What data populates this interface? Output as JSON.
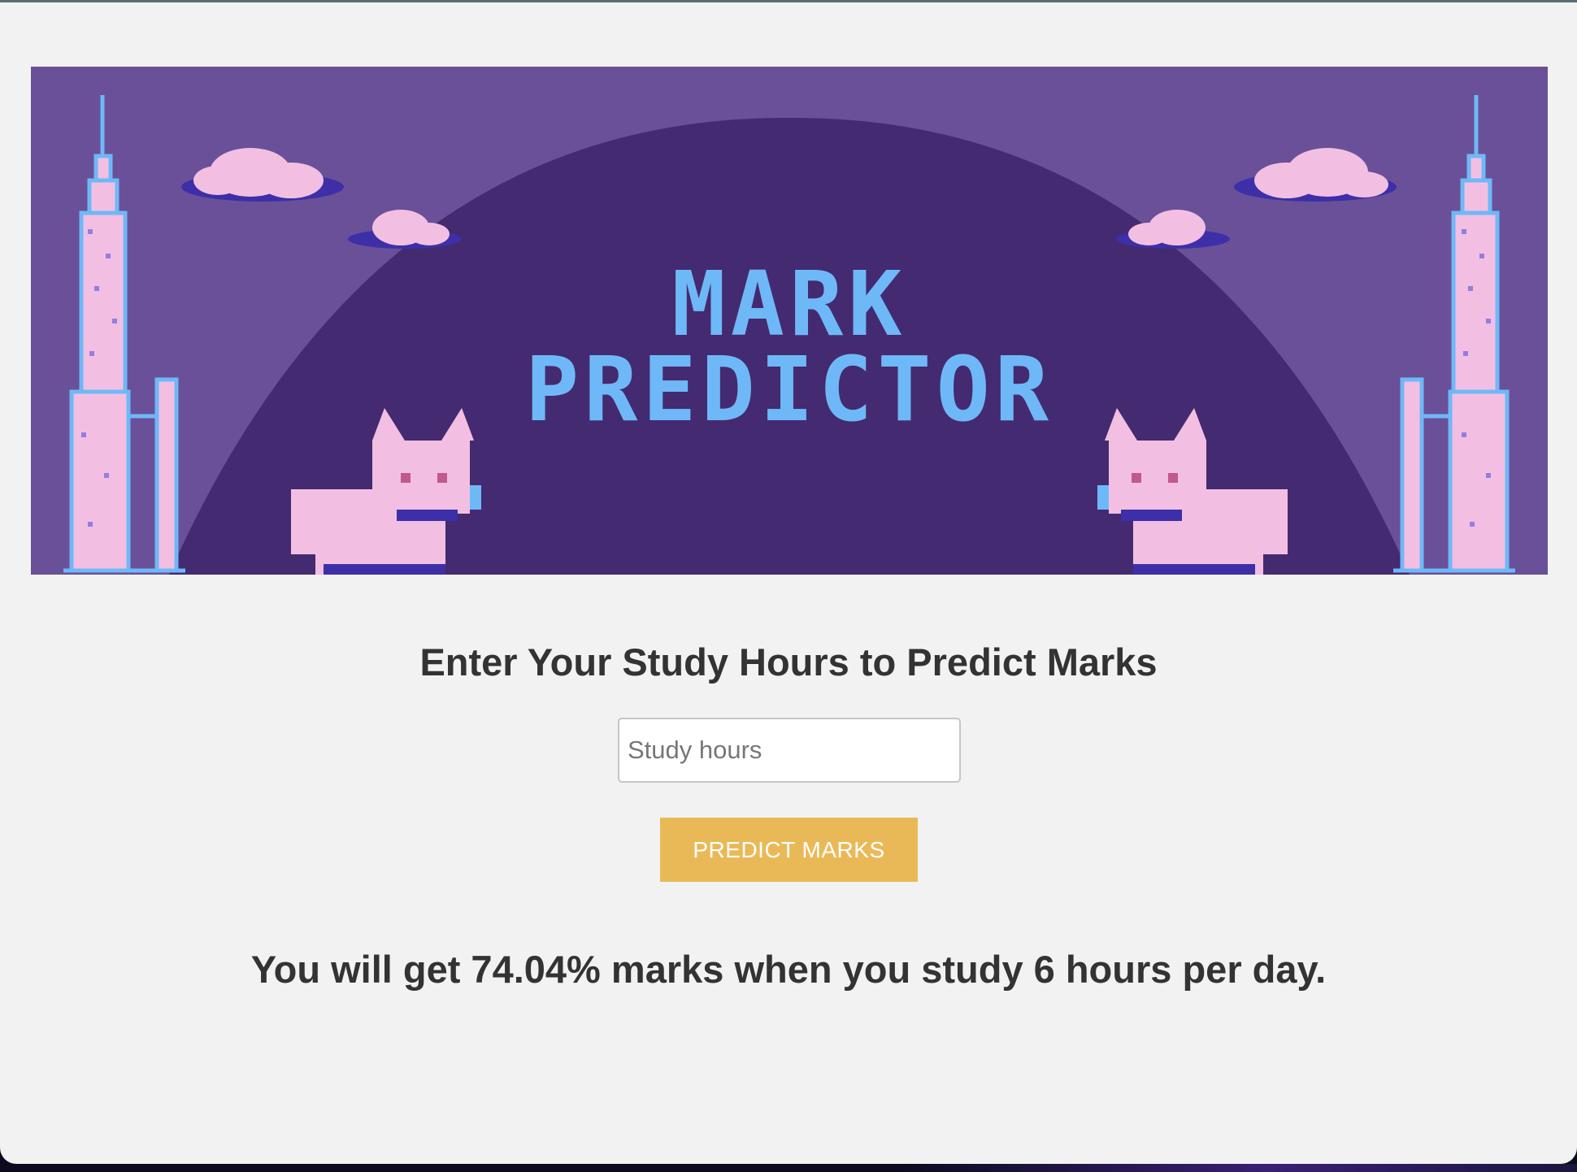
{
  "banner": {
    "title_line1": "MARK",
    "title_line2": "PREDICTOR",
    "background_color": "#6a5099",
    "dome_color": "#442a70",
    "title_color": "#6fb8f7",
    "decorations": [
      "tower-icon",
      "cloud-icon",
      "cat-icon"
    ]
  },
  "main": {
    "heading": "Enter Your Study Hours to Predict Marks",
    "input": {
      "placeholder": "Study hours",
      "value": ""
    },
    "button_label": "PREDICT MARKS",
    "result_text": "You will get 74.04% marks when you study 6 hours per day."
  },
  "colors": {
    "page_background": "#f2f2f2",
    "button": "#eab957",
    "text": "#333333"
  }
}
